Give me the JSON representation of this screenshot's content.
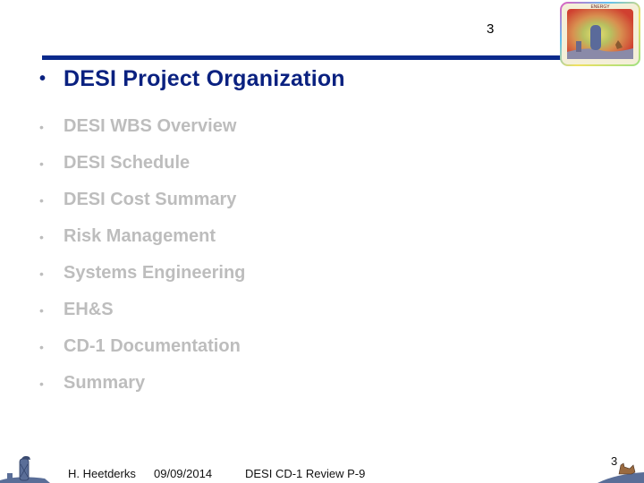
{
  "header": {
    "page_number": "3",
    "logo": "energy-ornate-logo-icon"
  },
  "title": {
    "bullet": "•",
    "text": "DESI Project Organization"
  },
  "agenda": {
    "bullet": "•",
    "items": [
      {
        "label": "DESI WBS Overview"
      },
      {
        "label": "DESI Schedule"
      },
      {
        "label": "DESI Cost Summary"
      },
      {
        "label": "Risk Management"
      },
      {
        "label": "Systems Engineering"
      },
      {
        "label": "EH&S"
      },
      {
        "label": "CD-1 Documentation"
      },
      {
        "label": "Summary"
      }
    ]
  },
  "footer": {
    "author": "H. Heetderks",
    "date": "09/09/2014",
    "title": "DESI CD-1 Review  P-9",
    "page_number": "3"
  },
  "colors": {
    "accent": "#0a2180",
    "rule": "#0a2a8c",
    "inactive_text": "#bdbdbd"
  }
}
